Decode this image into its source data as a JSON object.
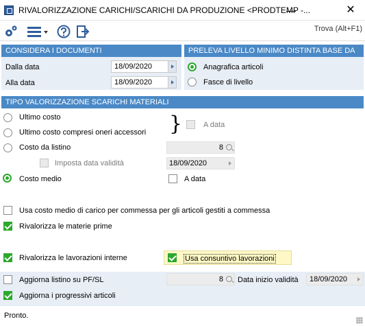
{
  "window": {
    "title": "RIVALORIZZAZIONE CARICHI/SCARICHI DA PRODUZIONE <PRODTEMP -...",
    "minimize": "—",
    "close": "✕"
  },
  "toolbar": {
    "search_label": "Trova (Alt+F1)"
  },
  "considera": {
    "header": "CONSIDERA I DOCUMENTI",
    "dalla_label": "Dalla data",
    "dalla_value": "18/09/2020",
    "alla_label": "Alla data",
    "alla_value": "18/09/2020"
  },
  "preleva": {
    "header": "PRELEVA LIVELLO MINIMO DISTINTA BASE DA",
    "opt1": "Anagrafica articoli",
    "opt2": "Fasce di livello"
  },
  "tipo": {
    "header": "TIPO VALORIZZAZIONE SCARICHI MATERIALI",
    "ultimo_costo": "Ultimo costo",
    "ultimo_oneri": "Ultimo costo compresi oneri accessori",
    "costo_listino": "Costo da listino",
    "listino_value": "8",
    "imposta_data": "Imposta data validità",
    "imposta_value": "18/09/2020",
    "costo_medio": "Costo medio",
    "a_data_top": "A data",
    "a_data_medio": "A data",
    "brace": "}"
  },
  "options": {
    "usa_costo_medio": "Usa costo medio di carico per commessa per gli articoli gestiti a commessa",
    "rivalorizza_mp": "Rivalorizza le materie prime",
    "rivalorizza_lav": "Rivalorizza le lavorazioni interne",
    "usa_consuntivo": "Usa consuntivo lavorazioni",
    "aggiorna_listino": "Aggiorna listino su PF/SL",
    "aggiorna_listino_value": "8",
    "data_inizio_label": "Data inizio validità",
    "data_inizio_value": "18/09/2020",
    "aggiorna_progressivi": "Aggiorna i progressivi articoli"
  },
  "status": {
    "text": "Pronto."
  },
  "colors": {
    "header_blue": "#4a89c6",
    "panel_bg": "#e7eef6",
    "check_green": "#2ca82c"
  }
}
